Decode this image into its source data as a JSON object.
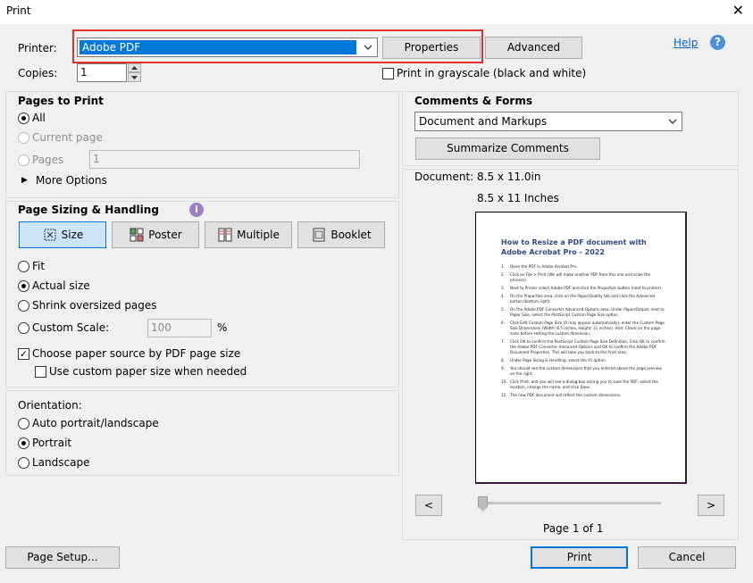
{
  "window": {
    "title": "Print",
    "close": "✕"
  },
  "printer": {
    "label": "Printer:",
    "selected": "Adobe PDF",
    "properties": "Properties",
    "advanced": "Advanced",
    "help": "Help"
  },
  "copies": {
    "label": "Copies:",
    "value": "1"
  },
  "grayscale": {
    "label": "Print in grayscale (black and white)",
    "checked": false
  },
  "pages_to_print": {
    "header": "Pages to Print",
    "all": "All",
    "current": "Current page",
    "pages": "Pages",
    "pages_value": "1",
    "more": "More Options"
  },
  "sizing": {
    "header": "Page Sizing & Handling",
    "size": "Size",
    "poster": "Poster",
    "multiple": "Multiple",
    "booklet": "Booklet",
    "fit": "Fit",
    "actual": "Actual size",
    "shrink": "Shrink oversized pages",
    "custom_scale": "Custom Scale:",
    "scale_value": "100",
    "percent": "%",
    "paper_source": "Choose paper source by PDF page size",
    "custom_paper": "Use custom paper size when needed"
  },
  "orientation": {
    "header": "Orientation:",
    "auto": "Auto portrait/landscape",
    "portrait": "Portrait",
    "landscape": "Landscape"
  },
  "comments": {
    "header": "Comments & Forms",
    "selected": "Document and Markups",
    "summarize": "Summarize Comments"
  },
  "preview": {
    "document": "Document: 8.5 x 11.0in",
    "size": "8.5 x 11 Inches",
    "prev": "<",
    "next": ">",
    "page_of": "Page 1 of 1",
    "doc_title": "How to Resize a PDF document with Adobe Acrobat Pro - 2022",
    "doc_items": [
      "Open the PDF in Adobe Acrobat Pro.",
      "Click on File > Print (We will make another PDF from this one and scale the process).",
      "Next to Printer select Adobe PDF and click the Properties button (next to printer).",
      "On the Properties area, click on the Paper/Quality tab and click the Advanced button (bottom right).",
      "On the Adobe PDF Converter Advanced Options area, Under Paper/Output, next to Paper Size, select the PostScript Custom Page Size option.",
      "Click Edit Custom Page Size (it may appear automatically), enter the Custom Page Size Dimensions (Width: 8.5 inches, Height: 11 inches). Hint: Check on the page sizes before setting the custom dimension.",
      "Click OK to confirm the PostScript Custom Page Size Definition, Click OK to confirm the Adobe PDF Converter Advanced Options and OK to confirm the Adobe PDF Document Properties. This will take you back to the Print area.",
      "Under Page Sizing & Handling, select the Fit option.",
      "You should see the custom dimensions that you entered above the page preview on the right.",
      "Click Print, and you will see a dialog box asking you to save the PDF, select the location, change the name, and click Save.",
      "The new PDF document will reflect the custom dimensions."
    ]
  },
  "footer": {
    "page_setup": "Page Setup...",
    "print": "Print",
    "cancel": "Cancel"
  },
  "colors": {
    "highlight_box": "#e0312f",
    "selection": "#0078d7",
    "help_link": "#0066cc"
  }
}
